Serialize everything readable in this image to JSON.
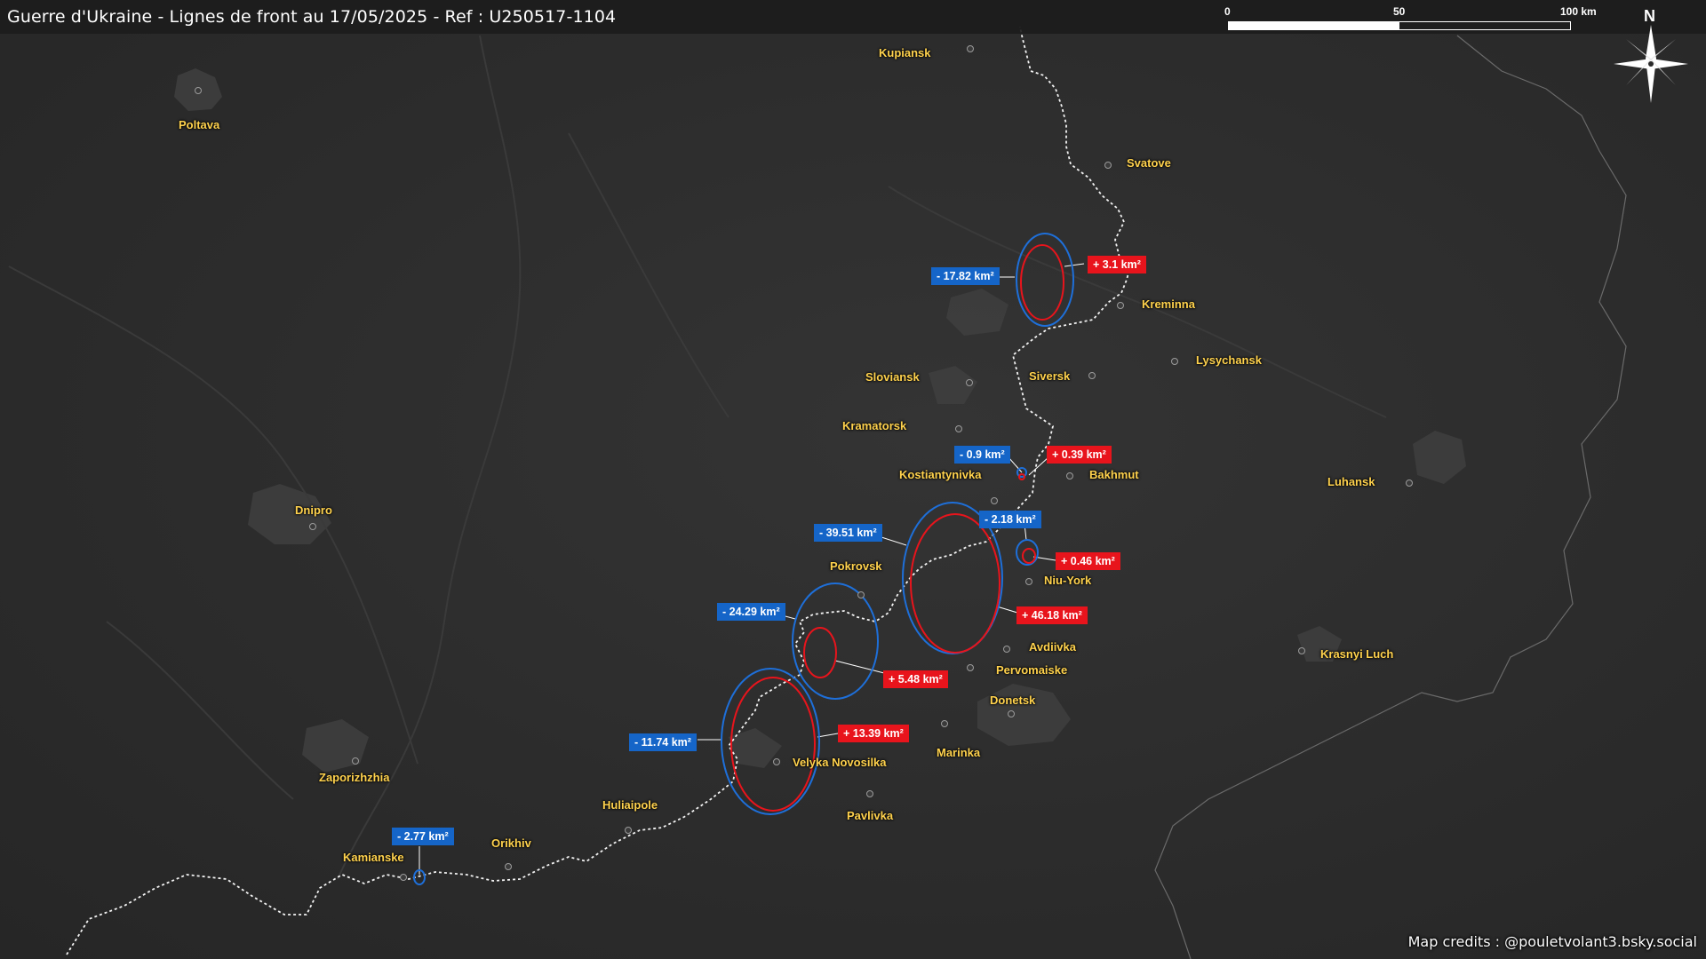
{
  "title": "Guerre d'Ukraine - Lignes de front au 17/05/2025 - Ref : U250517-1104",
  "scale_bar": {
    "labels": [
      "0",
      "50",
      "100 km"
    ]
  },
  "compass": {
    "north_label": "N"
  },
  "credits": "Map credits : @pouletvolant3.bsky.social",
  "colors": {
    "loss": "#1565c8",
    "gain": "#e8141c",
    "city_label": "#ffd24d",
    "frontline": "#ffffff"
  },
  "cities": [
    {
      "name": "Kupiansk"
    },
    {
      "name": "Poltava"
    },
    {
      "name": "Svatove"
    },
    {
      "name": "Kreminna"
    },
    {
      "name": "Lysychansk"
    },
    {
      "name": "Sloviansk"
    },
    {
      "name": "Siversk"
    },
    {
      "name": "Kramatorsk"
    },
    {
      "name": "Kostiantynivka"
    },
    {
      "name": "Bakhmut"
    },
    {
      "name": "Luhansk"
    },
    {
      "name": "Dnipro"
    },
    {
      "name": "Pokrovsk"
    },
    {
      "name": "Niu-York"
    },
    {
      "name": "Avdiivka"
    },
    {
      "name": "Pervomaiske"
    },
    {
      "name": "Donetsk"
    },
    {
      "name": "Krasnyi Luch"
    },
    {
      "name": "Marinka"
    },
    {
      "name": "Velyka Novosilka"
    },
    {
      "name": "Zaporizhzhia"
    },
    {
      "name": "Huliaipole"
    },
    {
      "name": "Pavlivka"
    },
    {
      "name": "Orikhiv"
    },
    {
      "name": "Kamianske"
    }
  ],
  "changes": [
    {
      "label": "- 17.82 km²",
      "kind": "loss"
    },
    {
      "label": "+ 3.1 km²",
      "kind": "gain"
    },
    {
      "label": "- 0.9 km²",
      "kind": "loss"
    },
    {
      "label": "+ 0.39 km²",
      "kind": "gain"
    },
    {
      "label": "- 2.18 km²",
      "kind": "loss"
    },
    {
      "label": "- 39.51 km²",
      "kind": "loss"
    },
    {
      "label": "+ 0.46 km²",
      "kind": "gain"
    },
    {
      "label": "+ 46.18 km²",
      "kind": "gain"
    },
    {
      "label": "- 24.29 km²",
      "kind": "loss"
    },
    {
      "label": "+ 5.48 km²",
      "kind": "gain"
    },
    {
      "label": "- 11.74 km²",
      "kind": "loss"
    },
    {
      "label": "+ 13.39 km²",
      "kind": "gain"
    },
    {
      "label": "- 2.77 km²",
      "kind": "loss"
    }
  ]
}
